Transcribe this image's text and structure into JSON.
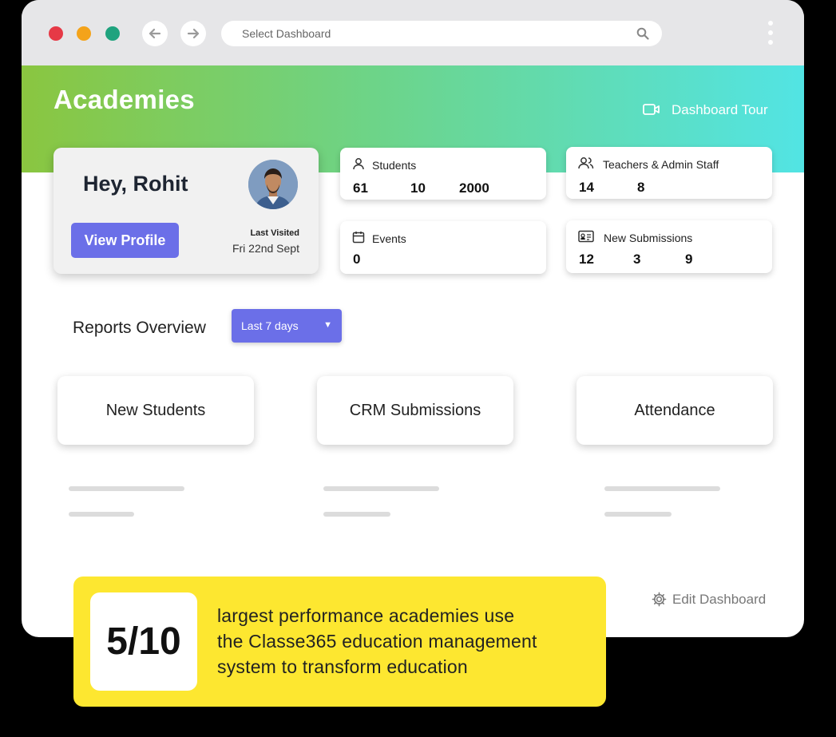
{
  "browser": {
    "address_placeholder": "Select Dashboard",
    "dot_colors": [
      "#e63946",
      "#f4a31a",
      "#1fa37e"
    ]
  },
  "header": {
    "title": "Academies",
    "tour_label": "Dashboard Tour"
  },
  "profile": {
    "greeting": "Hey, Rohit",
    "button_label": "View Profile",
    "last_visited_label": "Last Visited",
    "last_visited_date": "Fri 22nd Sept"
  },
  "stats": {
    "students": {
      "title": "Students",
      "values": [
        "61",
        "10",
        "2000"
      ]
    },
    "teachers": {
      "title": "Teachers & Admin Staff",
      "values": [
        "14",
        "8"
      ]
    },
    "events": {
      "title": "Events",
      "values": [
        "0"
      ]
    },
    "submissions": {
      "title": "New Submissions",
      "values": [
        "12",
        "3",
        "9"
      ]
    }
  },
  "reports": {
    "title": "Reports Overview",
    "range_selected": "Last 7 days",
    "tiles": [
      "New Students",
      "CRM Submissions",
      "Attendance"
    ]
  },
  "edit_label": "Edit Dashboard",
  "banner": {
    "stat": "5/10",
    "line1": "largest performance academies use",
    "line2": "the Classe365 education management",
    "line3": "system to transform education"
  },
  "colors": {
    "accent": "#6b6fe8",
    "banner": "#fde730",
    "gradient_start": "#8ac640",
    "gradient_end": "#52e4e4"
  }
}
